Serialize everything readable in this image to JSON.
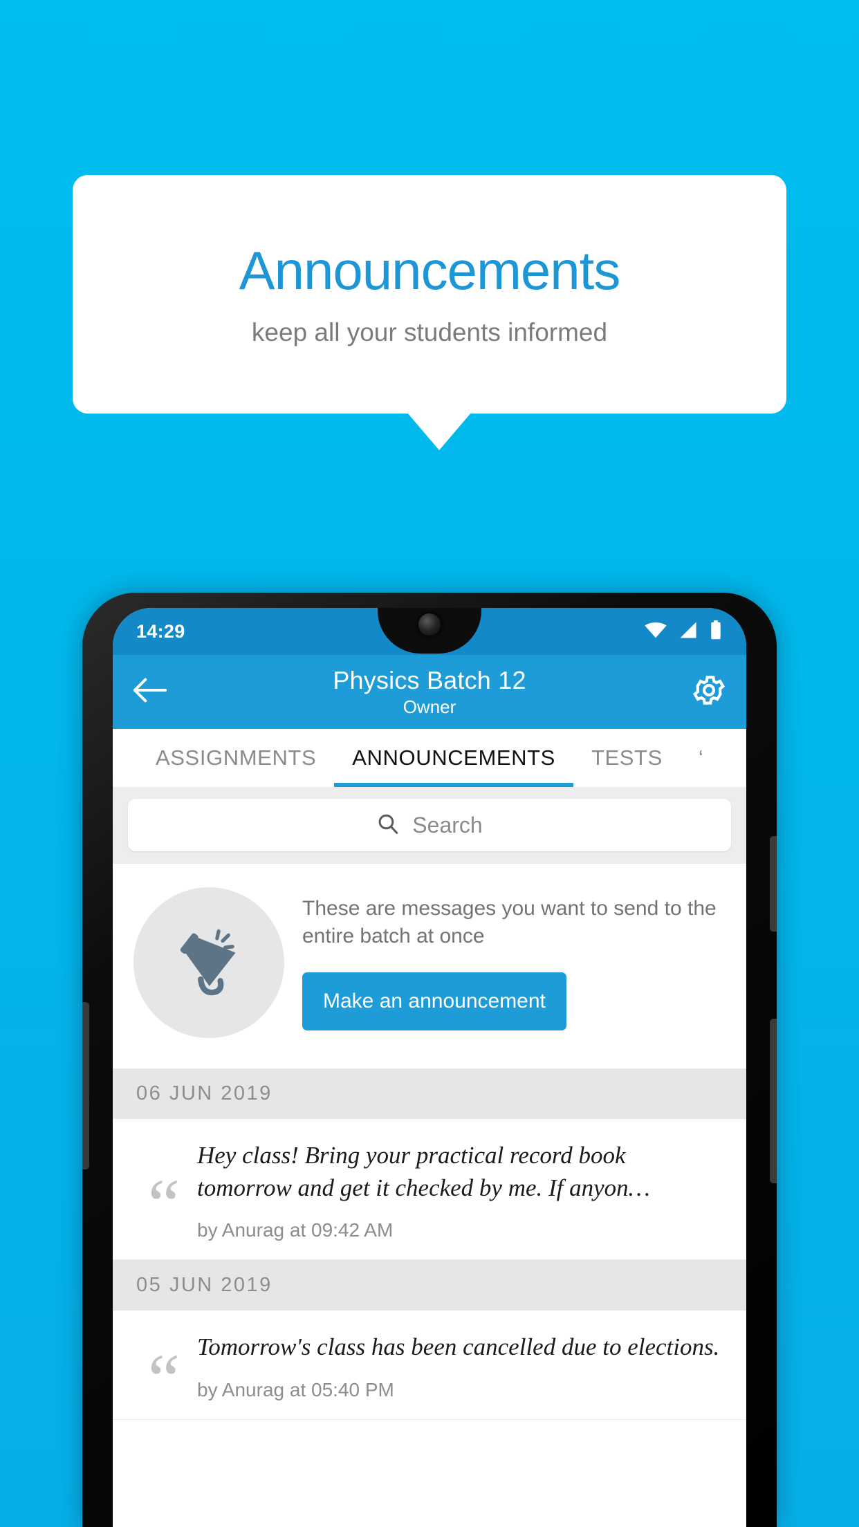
{
  "promo": {
    "title": "Announcements",
    "subtitle": "keep all your students informed",
    "title_color": "#1C96D4",
    "subtitle_color": "#7b7b7b"
  },
  "background": {
    "color": "#00BDEF"
  },
  "phone": {
    "status_bar": {
      "time": "14:29",
      "background": "#1389C8",
      "icons": [
        "wifi-icon",
        "signal-icon",
        "battery-icon"
      ]
    },
    "app_bar": {
      "background": "#1E9CD7",
      "back_icon": "back-arrow-icon",
      "title": "Physics Batch 12",
      "subtitle": "Owner",
      "settings_icon": "gear-icon"
    },
    "tabs": {
      "items": [
        {
          "label": "ASSIGNMENTS",
          "active": false
        },
        {
          "label": "ANNOUNCEMENTS",
          "active": true
        },
        {
          "label": "TESTS",
          "active": false
        },
        {
          "label": "‘",
          "active": false
        }
      ],
      "indicator_color": "#1E9CD7"
    },
    "search": {
      "icon": "search-icon",
      "placeholder": "Search",
      "value": ""
    },
    "announce_promo": {
      "icon": "megaphone-icon",
      "description": "These are messages you want to send to the entire batch at once",
      "button_label": "Make an announcement",
      "button_color": "#1E9CD7"
    },
    "announcement_groups": [
      {
        "date": "06  JUN  2019",
        "items": [
          {
            "quote_icon": "quote-icon",
            "text": "Hey class! Bring your practical record book tomorrow and get it checked by me. If anyon…",
            "meta": "by Anurag at 09:42 AM"
          }
        ]
      },
      {
        "date": "05  JUN  2019",
        "items": [
          {
            "quote_icon": "quote-icon",
            "text": "Tomorrow's class has been cancelled due to elections.",
            "meta": "by Anurag at 05:40 PM"
          }
        ]
      }
    ]
  }
}
